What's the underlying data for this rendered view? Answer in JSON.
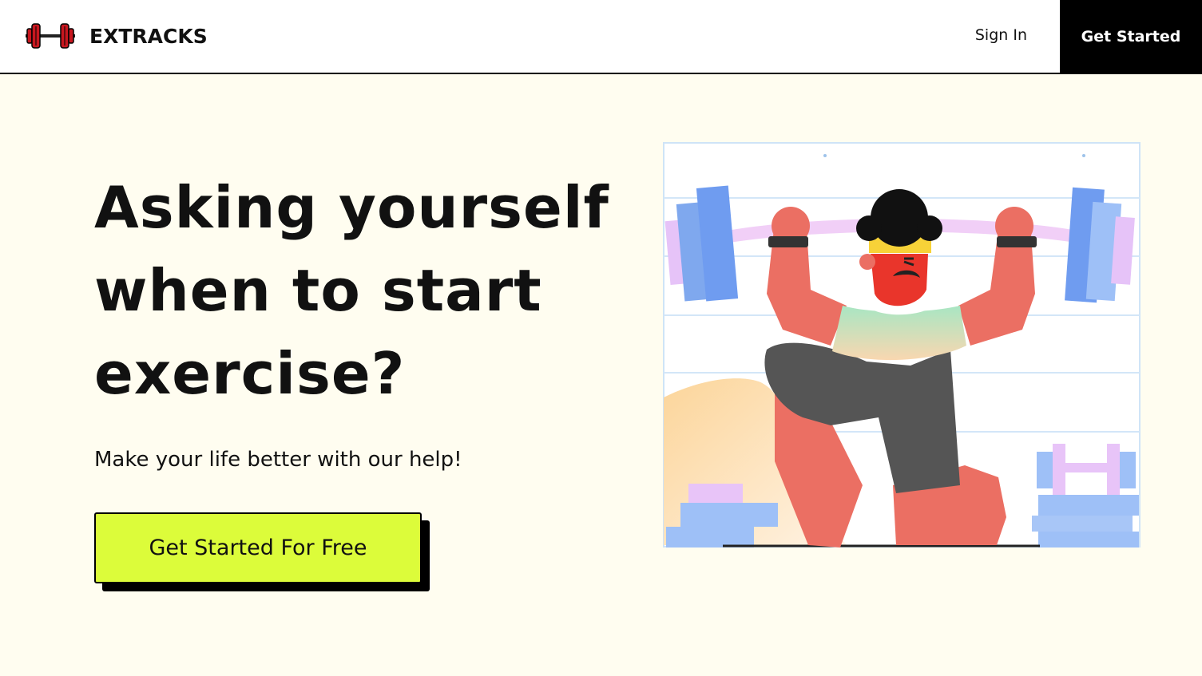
{
  "header": {
    "brand": "EXTRACKS",
    "logo_icon": "dumbbell-icon",
    "sign_in_label": "Sign In",
    "get_started_label": "Get Started"
  },
  "hero": {
    "title_line1": "Asking yourself",
    "title_line2": "when to start",
    "title_line3": "exercise?",
    "subtitle": "Make your life better with our help!",
    "cta_label": "Get Started For Free"
  },
  "colors": {
    "background": "#fffdf0",
    "accent": "#dcfc3a",
    "nav_button": "#000000",
    "logo_red": "#c8171f"
  }
}
